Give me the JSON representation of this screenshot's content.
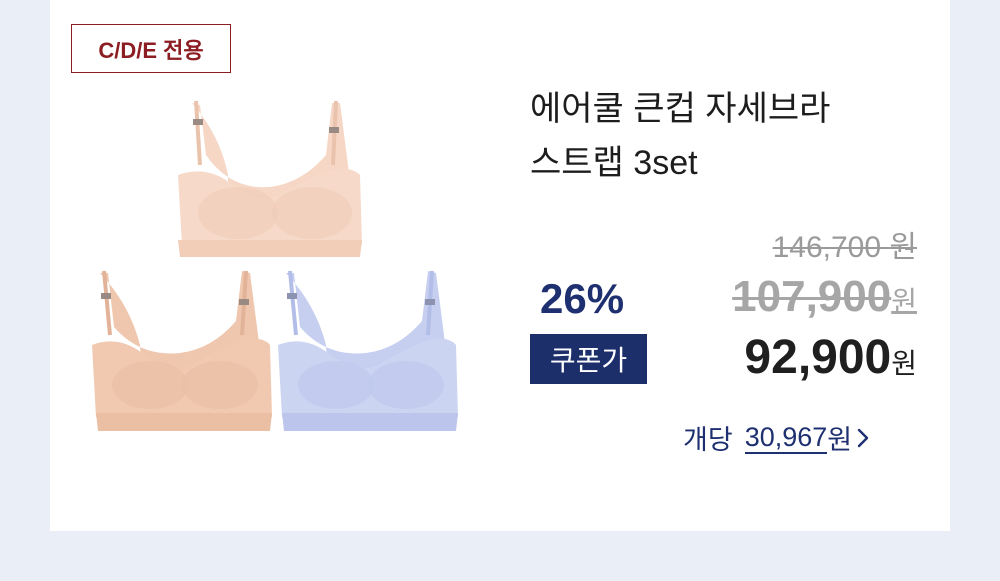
{
  "badge": "C/D/E 전용",
  "product": {
    "title_line1": "에어쿨 큰컵 자세브라",
    "title_line2": "스트랩 3set",
    "image_alt": "bra-set-3-pieces",
    "colors": {
      "peach": "#f6d7c6",
      "peach_dark": "#eec8b2",
      "nude": "#f0c9b0",
      "lavender": "#c9d2f0"
    }
  },
  "pricing": {
    "original": "146,700",
    "original_won": "원",
    "sale": "107,900",
    "sale_won": "원",
    "discount": "26%",
    "coupon_label": "쿠폰가",
    "final": "92,900",
    "final_won": "원",
    "unit_label": "개당",
    "unit_amount": "30,967",
    "unit_won": "원"
  },
  "colors": {
    "badge": "#8c1d22",
    "navy": "#1e3070",
    "background": "#e9eef7"
  }
}
